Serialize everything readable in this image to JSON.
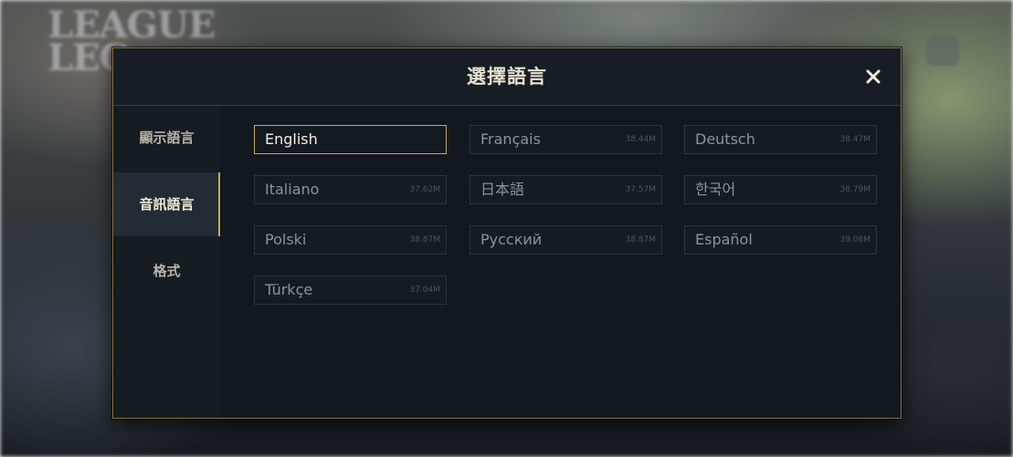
{
  "background": {
    "logo_text": "LEAGUE LEGENDS"
  },
  "dialog": {
    "title": "選擇語言",
    "close_icon": "close-icon"
  },
  "sidebar": {
    "items": [
      {
        "label": "顯示語言",
        "active": false
      },
      {
        "label": "音訊語言",
        "active": true
      },
      {
        "label": "格式",
        "active": false
      }
    ]
  },
  "languages": [
    {
      "name": "English",
      "size": "",
      "selected": true
    },
    {
      "name": "Français",
      "size": "38.44M",
      "selected": false
    },
    {
      "name": "Deutsch",
      "size": "38.47M",
      "selected": false
    },
    {
      "name": "Italiano",
      "size": "37.62M",
      "selected": false
    },
    {
      "name": "日本語",
      "size": "37.57M",
      "selected": false
    },
    {
      "name": "한국어",
      "size": "38.79M",
      "selected": false
    },
    {
      "name": "Polski",
      "size": "38.87M",
      "selected": false
    },
    {
      "name": "Русский",
      "size": "38.87M",
      "selected": false
    },
    {
      "name": "Español",
      "size": "39.08M",
      "selected": false
    },
    {
      "name": "Türkçe",
      "size": "37.04M",
      "selected": false
    }
  ],
  "colors": {
    "accent_gold": "#c8a95c",
    "panel": "#111820",
    "title_text": "#e8e2d2"
  }
}
